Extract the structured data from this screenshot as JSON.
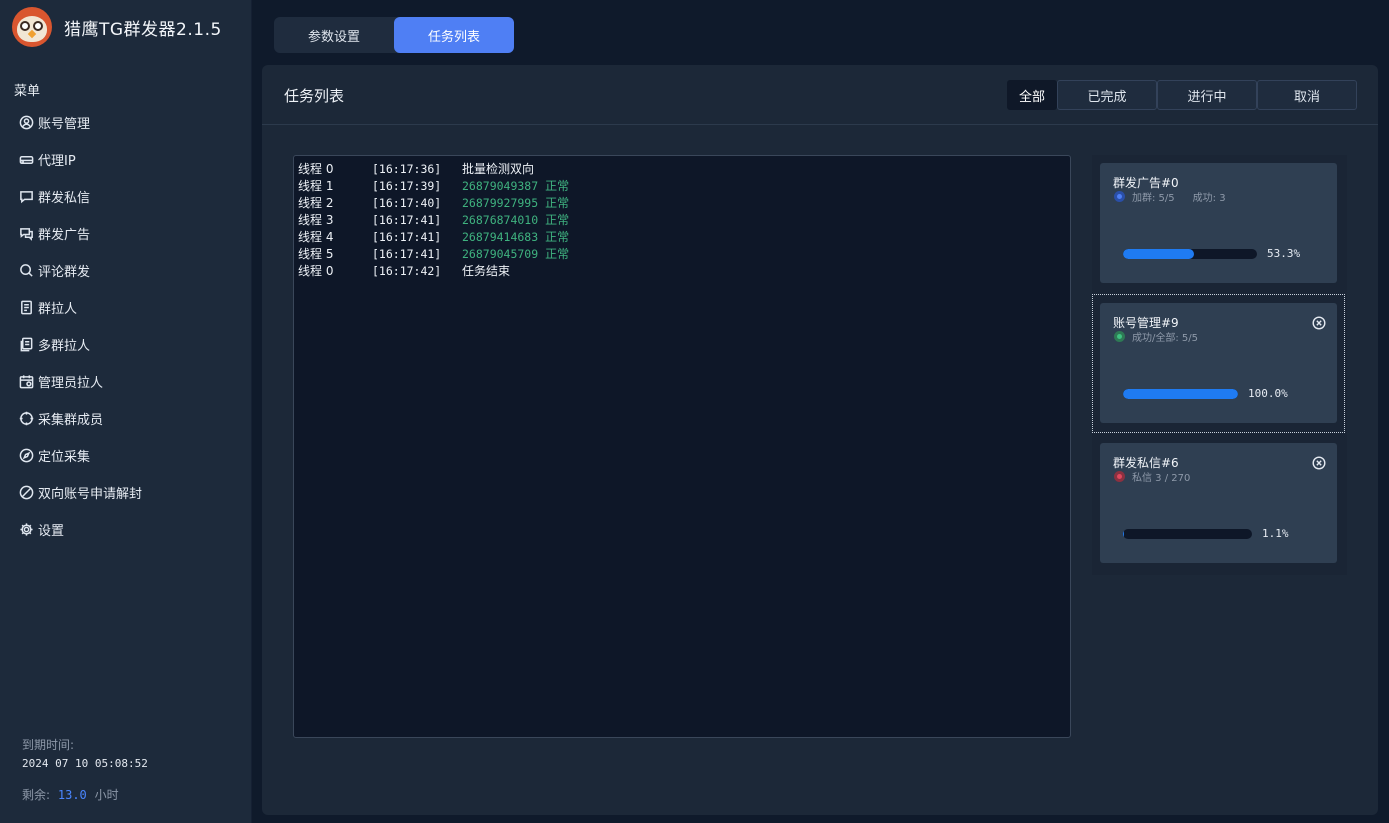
{
  "app": {
    "title": "猎鹰TG群发器2.1.5"
  },
  "sidebar": {
    "menu_heading": "菜单",
    "items": [
      {
        "label": "账号管理",
        "icon": "user-circle-icon"
      },
      {
        "label": "代理IP",
        "icon": "router-icon"
      },
      {
        "label": "群发私信",
        "icon": "chat-bubble-icon"
      },
      {
        "label": "群发广告",
        "icon": "chat-bubbles-icon"
      },
      {
        "label": "评论群发",
        "icon": "comment-search-icon"
      },
      {
        "label": "群拉人",
        "icon": "document-list-icon"
      },
      {
        "label": "多群拉人",
        "icon": "documents-icon"
      },
      {
        "label": "管理员拉人",
        "icon": "calendar-user-icon"
      },
      {
        "label": "采集群成员",
        "icon": "target-icon"
      },
      {
        "label": "定位采集",
        "icon": "compass-icon"
      },
      {
        "label": "双向账号申请解封",
        "icon": "ban-icon"
      },
      {
        "label": "设置",
        "icon": "gear-icon"
      }
    ],
    "expire_label": "到期时间:",
    "expire_value": "2024 07 10 05:08:52",
    "remain_label": "剩余:",
    "remain_value": "13.0",
    "remain_unit": "小时"
  },
  "top_tabs": [
    {
      "label": "参数设置",
      "active": false
    },
    {
      "label": "任务列表",
      "active": true
    }
  ],
  "panel": {
    "title": "任务列表",
    "filters": [
      "全部",
      "已完成",
      "进行中",
      "取消"
    ],
    "log": [
      {
        "thread": "线程 0",
        "time": "[16:17:36]",
        "text": "批量检测双向",
        "number": "",
        "status": ""
      },
      {
        "thread": "线程 1",
        "time": "[16:17:39]",
        "text": "",
        "number": "26879049387",
        "status": "正常"
      },
      {
        "thread": "线程 2",
        "time": "[16:17:40]",
        "text": "",
        "number": "26879927995",
        "status": "正常"
      },
      {
        "thread": "线程 3",
        "time": "[16:17:41]",
        "text": "",
        "number": "26876874010",
        "status": "正常"
      },
      {
        "thread": "线程 4",
        "time": "[16:17:41]",
        "text": "",
        "number": "26879414683",
        "status": "正常"
      },
      {
        "thread": "线程 5",
        "time": "[16:17:41]",
        "text": "",
        "number": "26879045709",
        "status": "正常"
      },
      {
        "thread": "线程 0",
        "time": "[16:17:42]",
        "text": "任务结束",
        "number": "",
        "status": ""
      }
    ],
    "tasks": [
      {
        "title": "群发广告#0",
        "status_color": "blue",
        "sub1": "加群: 5/5",
        "sub2": "成功: 3",
        "progress": 0.533,
        "pct_label": "53.3%",
        "closable": false,
        "selected": false
      },
      {
        "title": "账号管理#9",
        "status_color": "green",
        "sub1": "成功/全部: 5/5",
        "sub2": "",
        "progress": 1.0,
        "pct_label": "100.0%",
        "closable": true,
        "selected": true
      },
      {
        "title": "群发私信#6",
        "status_color": "red",
        "sub1": "私信 3 / 270",
        "sub2": "",
        "progress": 0.011,
        "pct_label": "1.1%",
        "closable": true,
        "selected": false
      }
    ]
  }
}
